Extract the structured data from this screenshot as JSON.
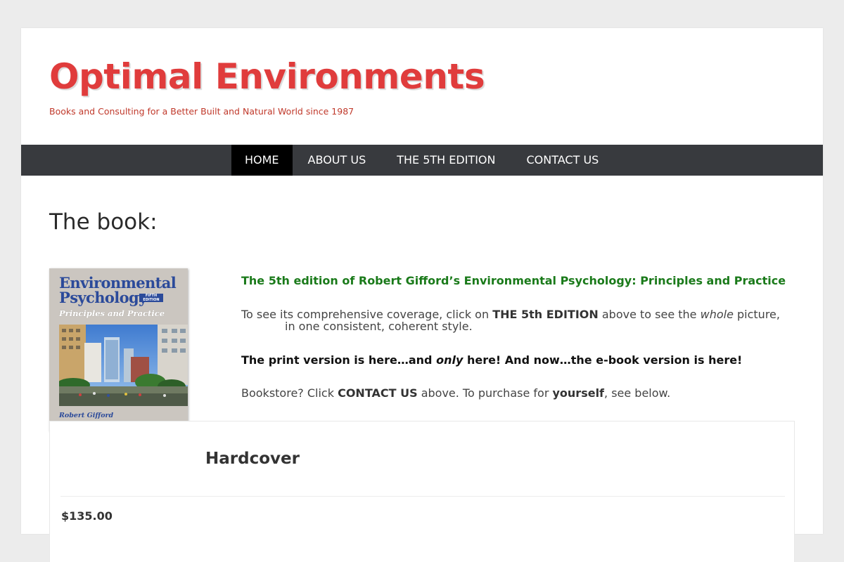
{
  "header": {
    "site_title": "Optimal Environments",
    "tagline": "Books and Consulting for a Better Built and Natural World since 1987"
  },
  "nav": {
    "items": [
      {
        "label": "HOME",
        "active": true
      },
      {
        "label": "ABOUT US",
        "active": false
      },
      {
        "label": "THE 5TH EDITION",
        "active": false
      },
      {
        "label": "CONTACT US",
        "active": false
      }
    ]
  },
  "main": {
    "heading": "The book:",
    "cover": {
      "title_line1": "Environmental",
      "title_line2": "Psychology",
      "edition_badge": "FIFTH EDITION",
      "subtitle": "Principles and Practice",
      "author": "Robert Gifford"
    },
    "headline": "The 5th edition of Robert Gifford’s Environmental Psychology: Principles and Practice",
    "para1": {
      "text1": "To see its comprehensive coverage, click on ",
      "bold": "THE 5th EDITION",
      "text2": " above to see the ",
      "italic": "whole",
      "text3": " picture,",
      "line2": "in one consistent, coherent style."
    },
    "para2": {
      "text1": "The print version is here…and ",
      "italic": "only",
      "text2": " here! And now…the e-book version is here!"
    },
    "para3": {
      "text1": "Bookstore? Click ",
      "bold1": "CONTACT US",
      "text2": " above.  To purchase for ",
      "bold2": "yourself",
      "text3": ", see below."
    }
  },
  "product": {
    "title": "Hardcover",
    "price": "$135.00"
  },
  "colors": {
    "brand_red": "#e03c3c",
    "nav_bg": "#383a3e",
    "nav_active_bg": "#000000",
    "headline_green": "#1a7a1a"
  }
}
